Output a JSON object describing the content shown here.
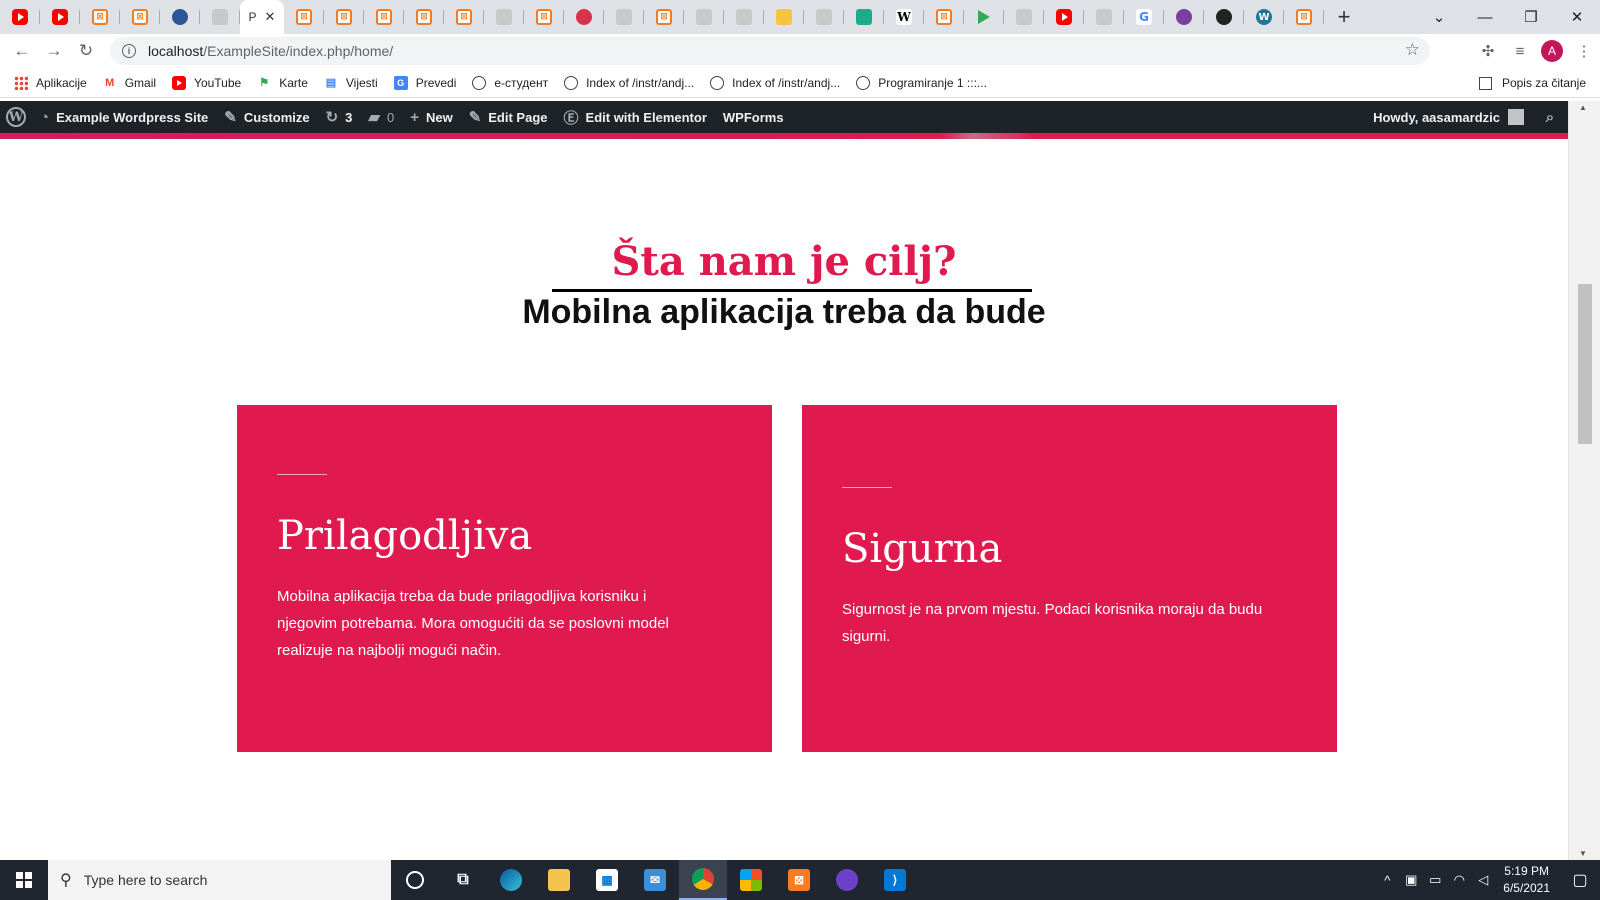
{
  "browser": {
    "active_tab_label": "P",
    "url_host": "localhost",
    "url_path": "/ExampleSite/index.php/home/",
    "profile_initial": "A",
    "bookmarks": [
      {
        "label": "Aplikacije",
        "icon": "apps-icon"
      },
      {
        "label": "Gmail",
        "icon": "gmail-icon"
      },
      {
        "label": "YouTube",
        "icon": "youtube-icon"
      },
      {
        "label": "Karte",
        "icon": "maps-icon"
      },
      {
        "label": "Vijesti",
        "icon": "news-icon"
      },
      {
        "label": "Prevedi",
        "icon": "translate-icon"
      },
      {
        "label": "e-студент",
        "icon": "globe-icon"
      },
      {
        "label": "Index of /instr/andj...",
        "icon": "globe-icon"
      },
      {
        "label": "Index of /instr/andj...",
        "icon": "globe-icon"
      },
      {
        "label": "Programiranje 1 :::...",
        "icon": "globe-icon"
      }
    ],
    "reading_list": "Popis za čitanje"
  },
  "adminbar": {
    "site_name": "Example Wordpress Site",
    "customize": "Customize",
    "updates_count": "3",
    "comments_count": "0",
    "new": "New",
    "edit_page": "Edit Page",
    "edit_elementor": "Edit with Elementor",
    "wpforms": "WPForms",
    "howdy": "Howdy, aasamardzic"
  },
  "content": {
    "heading": "Šta nam je cilj?",
    "subheading": "Mobilna aplikacija treba da bude",
    "cards": [
      {
        "title": "Prilagodljiva",
        "text": "Mobilna aplikacija treba da bude prilagodljiva korisniku i njegovim potrebama. Mora omogućiti da se poslovni model realizuje na najbolji mogući način."
      },
      {
        "title": "Sigurna",
        "text": "Sigurnost je na prvom mjestu. Podaci korisnika moraju da budu sigurni."
      }
    ]
  },
  "taskbar": {
    "search_placeholder": "Type here to search",
    "time": "5:19 PM",
    "date": "6/5/2021"
  },
  "colors": {
    "accent": "#e0194f",
    "adminbar": "#1d2327",
    "taskbar": "#1f2630"
  }
}
